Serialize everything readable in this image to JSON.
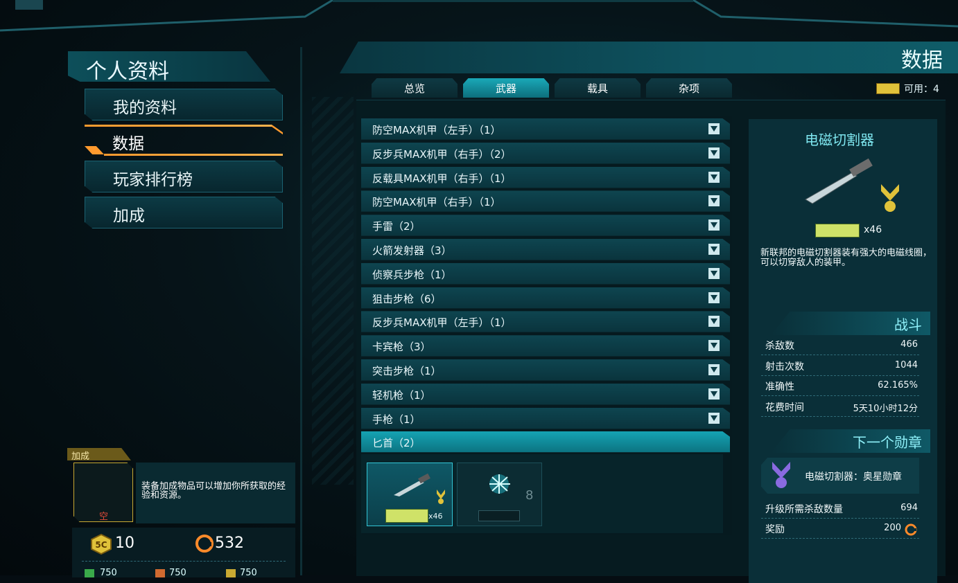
{
  "left_panel": {
    "title": "个人资料",
    "nav": [
      {
        "label": "我的资料"
      },
      {
        "label": "数据"
      },
      {
        "label": "玩家排行榜"
      },
      {
        "label": "加成"
      }
    ],
    "bonus": {
      "tag": "加成",
      "slot_text": "空",
      "description": "装备加成物品可以增加你所获取的经验和资源。"
    },
    "currency": {
      "certs": "10",
      "cash": "532",
      "small": [
        "750",
        "750",
        "750"
      ]
    }
  },
  "center": {
    "title": "数据",
    "tabs": [
      {
        "label": "总览"
      },
      {
        "label": "武器"
      },
      {
        "label": "载具"
      },
      {
        "label": "杂项"
      }
    ],
    "available_label": "可用：4",
    "weapon_categories": [
      {
        "label": "防空MAX机甲（左手）（1）"
      },
      {
        "label": "反步兵MAX机甲（右手）（2）"
      },
      {
        "label": "反载具MAX机甲（右手）（1）"
      },
      {
        "label": "防空MAX机甲（右手）（1）"
      },
      {
        "label": "手雷（2）"
      },
      {
        "label": "火箭发射器（3）"
      },
      {
        "label": "侦察兵步枪（1）"
      },
      {
        "label": "狙击步枪（6）"
      },
      {
        "label": "反步兵MAX机甲（左手）（1）"
      },
      {
        "label": "卡宾枪（3）"
      },
      {
        "label": "突击步枪（1）"
      },
      {
        "label": "轻机枪（1）"
      },
      {
        "label": "手枪（1）"
      }
    ],
    "open_category": {
      "label": "匕首（2）"
    },
    "weapon_cards": [
      {
        "count": "x46"
      },
      {
        "count": "8"
      }
    ]
  },
  "detail": {
    "name": "电磁切割器",
    "count": "x46",
    "description": "新联邦的电磁切割器装有强大的电磁线圈，可以切穿敌人的装甲。",
    "combat_header": "战斗",
    "stats": [
      {
        "key": "杀敌数",
        "value": "466"
      },
      {
        "key": "射击次数",
        "value": "1044"
      },
      {
        "key": "准确性",
        "value": "62.165%"
      },
      {
        "key": "花费时间",
        "value": "5天10小时12分"
      }
    ],
    "next_medal_header": "下一个勋章",
    "next_medal_name": "电磁切割器：奥星勋章",
    "medal_stats": [
      {
        "key": "升级所需杀敌数量",
        "value": "694"
      },
      {
        "key": "奖励",
        "value": "200"
      }
    ]
  },
  "colors": {
    "accent_cyan": "#15a3b3",
    "active_orange": "#ff9a2e",
    "gold": "#e0c23a"
  }
}
